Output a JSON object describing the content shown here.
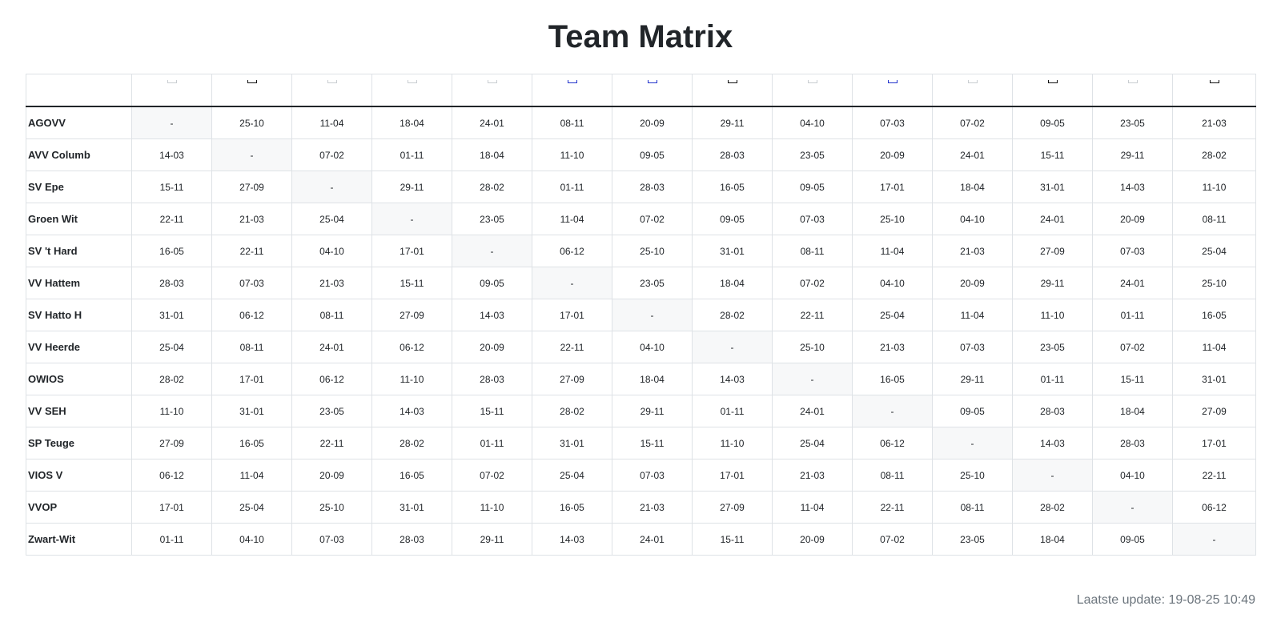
{
  "page": {
    "title": "Team Matrix",
    "last_update": "Laatste update: 19-08-25 10:49"
  },
  "header_logo_colors": [
    "#c9cdd1",
    "#111111",
    "#c9cdd1",
    "#c9cdd1",
    "#c9cdd1",
    "#2233cc",
    "#2233cc",
    "#111111",
    "#c9cdd1",
    "#2233cc",
    "#c9cdd1",
    "#111111",
    "#c9cdd1",
    "#111111"
  ],
  "teams": [
    {
      "name": "AGOVV",
      "dates": [
        "-",
        "25-10",
        "11-04",
        "18-04",
        "24-01",
        "08-11",
        "20-09",
        "29-11",
        "04-10",
        "07-03",
        "07-02",
        "09-05",
        "23-05",
        "21-03"
      ]
    },
    {
      "name": "AVV Columb",
      "dates": [
        "14-03",
        "-",
        "07-02",
        "01-11",
        "18-04",
        "11-10",
        "09-05",
        "28-03",
        "23-05",
        "20-09",
        "24-01",
        "15-11",
        "29-11",
        "28-02"
      ]
    },
    {
      "name": "SV Epe",
      "dates": [
        "15-11",
        "27-09",
        "-",
        "29-11",
        "28-02",
        "01-11",
        "28-03",
        "16-05",
        "09-05",
        "17-01",
        "18-04",
        "31-01",
        "14-03",
        "11-10"
      ]
    },
    {
      "name": "Groen Wit",
      "dates": [
        "22-11",
        "21-03",
        "25-04",
        "-",
        "23-05",
        "11-04",
        "07-02",
        "09-05",
        "07-03",
        "25-10",
        "04-10",
        "24-01",
        "20-09",
        "08-11"
      ]
    },
    {
      "name": "SV 't Hard",
      "dates": [
        "16-05",
        "22-11",
        "04-10",
        "17-01",
        "-",
        "06-12",
        "25-10",
        "31-01",
        "08-11",
        "11-04",
        "21-03",
        "27-09",
        "07-03",
        "25-04"
      ]
    },
    {
      "name": "VV Hattem",
      "dates": [
        "28-03",
        "07-03",
        "21-03",
        "15-11",
        "09-05",
        "-",
        "23-05",
        "18-04",
        "07-02",
        "04-10",
        "20-09",
        "29-11",
        "24-01",
        "25-10"
      ]
    },
    {
      "name": "SV Hatto H",
      "dates": [
        "31-01",
        "06-12",
        "08-11",
        "27-09",
        "14-03",
        "17-01",
        "-",
        "28-02",
        "22-11",
        "25-04",
        "11-04",
        "11-10",
        "01-11",
        "16-05"
      ]
    },
    {
      "name": "VV Heerde",
      "dates": [
        "25-04",
        "08-11",
        "24-01",
        "06-12",
        "20-09",
        "22-11",
        "04-10",
        "-",
        "25-10",
        "21-03",
        "07-03",
        "23-05",
        "07-02",
        "11-04"
      ]
    },
    {
      "name": "OWIOS",
      "dates": [
        "28-02",
        "17-01",
        "06-12",
        "11-10",
        "28-03",
        "27-09",
        "18-04",
        "14-03",
        "-",
        "16-05",
        "29-11",
        "01-11",
        "15-11",
        "31-01"
      ]
    },
    {
      "name": "VV SEH",
      "dates": [
        "11-10",
        "31-01",
        "23-05",
        "14-03",
        "15-11",
        "28-02",
        "29-11",
        "01-11",
        "24-01",
        "-",
        "09-05",
        "28-03",
        "18-04",
        "27-09"
      ]
    },
    {
      "name": "SP Teuge",
      "dates": [
        "27-09",
        "16-05",
        "22-11",
        "28-02",
        "01-11",
        "31-01",
        "15-11",
        "11-10",
        "25-04",
        "06-12",
        "-",
        "14-03",
        "28-03",
        "17-01"
      ]
    },
    {
      "name": "VIOS V",
      "dates": [
        "06-12",
        "11-04",
        "20-09",
        "16-05",
        "07-02",
        "25-04",
        "07-03",
        "17-01",
        "21-03",
        "08-11",
        "25-10",
        "-",
        "04-10",
        "22-11"
      ]
    },
    {
      "name": "VVOP",
      "dates": [
        "17-01",
        "25-04",
        "25-10",
        "31-01",
        "11-10",
        "16-05",
        "21-03",
        "27-09",
        "11-04",
        "22-11",
        "08-11",
        "28-02",
        "-",
        "06-12"
      ]
    },
    {
      "name": "Zwart-Wit",
      "dates": [
        "01-11",
        "04-10",
        "07-03",
        "28-03",
        "29-11",
        "14-03",
        "24-01",
        "15-11",
        "20-09",
        "07-02",
        "23-05",
        "18-04",
        "09-05",
        "-"
      ]
    }
  ]
}
